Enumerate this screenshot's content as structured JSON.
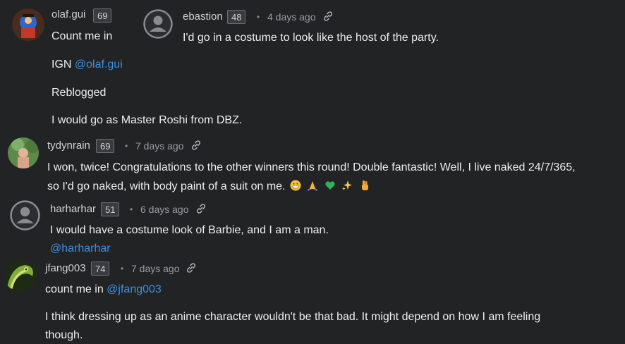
{
  "comments": [
    {
      "username": "olaf.gui",
      "karma": "69",
      "lines": [
        "Count me in",
        "IGN",
        "Reblogged",
        "I would go as Master Roshi from DBZ."
      ],
      "mention": "@olaf.gui"
    },
    {
      "username": "ebastion",
      "karma": "48",
      "time": "4 days ago",
      "text": "I'd go in a costume to look like the host of the party."
    },
    {
      "username": "tydynrain",
      "karma": "69",
      "time": "7 days ago",
      "line1": "I won, twice! Congratulations to the other winners this round! Double fantastic! Well, I live naked 24/7/365,",
      "line2": "so I'd go naked, with body paint of a suit on me.",
      "emojis": [
        "grinning-face",
        "folded-hands",
        "green-heart",
        "sparkles",
        "pinched-hand"
      ]
    },
    {
      "username": "harharhar",
      "karma": "51",
      "time": "6 days ago",
      "text": "I would have a costume look of Barbie, and I am a man.",
      "mention": "@harharhar"
    },
    {
      "username": "jfang003",
      "karma": "74",
      "time": "7 days ago",
      "line1": "count me in",
      "mention": "@jfang003",
      "line2a": "I think dressing up as an anime character wouldn't be that bad. It might depend on how I am feeling",
      "line2b": "though."
    }
  ],
  "separator": "•",
  "colors": {
    "background": "#222325",
    "mention": "#3b8fe0",
    "text": "#ededee",
    "muted": "#9a9b9f"
  }
}
